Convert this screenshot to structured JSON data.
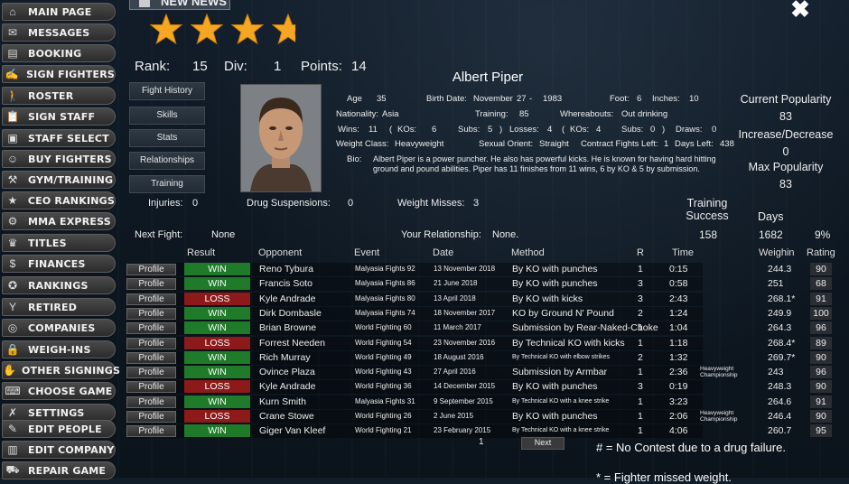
{
  "sidebar": {
    "items": [
      {
        "label": "MAIN PAGE",
        "icon": "house-icon"
      },
      {
        "label": "MESSAGES",
        "icon": "envelope-icon"
      },
      {
        "label": "BOOKING",
        "icon": "document-icon"
      },
      {
        "label": "SIGN FIGHTERS",
        "icon": "contract-icon"
      },
      {
        "label": "ROSTER",
        "icon": "fighter-icon"
      },
      {
        "label": "SIGN STAFF",
        "icon": "clipboard-icon"
      },
      {
        "label": "STAFF SELECT",
        "icon": "cube-icon"
      },
      {
        "label": "BUY FIGHTERS",
        "icon": "portrait-icon"
      },
      {
        "label": "GYM/TRAINING",
        "icon": "dumbbell-icon"
      },
      {
        "label": "CEO RANKINGS",
        "icon": "star-icon"
      },
      {
        "label": "MMA EXPRESS",
        "icon": "gear-icon"
      },
      {
        "label": "TITLES",
        "icon": "trophy-icon"
      },
      {
        "label": "FINANCES",
        "icon": "money-bag-icon"
      },
      {
        "label": "RANKINGS",
        "icon": "medal-icon"
      },
      {
        "label": "RETIRED",
        "icon": "cocktail-icon"
      },
      {
        "label": "COMPANIES",
        "icon": "globe-icon"
      },
      {
        "label": "WEIGH-INS",
        "icon": "lock-icon"
      },
      {
        "label": "OTHER SIGNINGS",
        "icon": "handshake-icon"
      },
      {
        "label": "CHOOSE GAME",
        "icon": "controller-icon"
      },
      {
        "label": "SETTINGS",
        "icon": "wrench-icon"
      },
      {
        "label": "EDIT PEOPLE",
        "icon": "pencil-icon"
      },
      {
        "label": "EDIT COMPANY",
        "icon": "building-icon"
      },
      {
        "label": "REPAIR GAME",
        "icon": "car-icon"
      }
    ]
  },
  "header": {
    "news_label": "NEW NEWS",
    "stars": 3.5
  },
  "summary": {
    "rank_label": "Rank:",
    "rank": "15",
    "div_label": "Div:",
    "div": "1",
    "points_label": "Points:",
    "points": "14"
  },
  "fighter": {
    "name": "Albert Piper",
    "age_label": "Age",
    "age": "35",
    "birth_label": "Birth Date:",
    "birth_month": "November",
    "birth_day": "27",
    "birth_year": "1983",
    "foot_label": "Foot:",
    "foot": "6",
    "inches_label": "Inches:",
    "inches": "10",
    "nationality_label": "Nationality:",
    "nationality": "Asia",
    "training_label": "Training:",
    "training": "85",
    "whereabouts_label": "Whereabouts:",
    "whereabouts": "Out drinking",
    "wins_label": "Wins:",
    "wins": "11",
    "kos_label": "KOs:",
    "kos": "6",
    "subs_label": "Subs:",
    "subs": "5",
    "losses_label": "Losses:",
    "losses": "4",
    "kos2": "4",
    "subs2": "0",
    "draws_label": "Draws:",
    "draws": "0",
    "weight_class_label": "Weight Class:",
    "weight_class": "Heavyweight",
    "orient_label": "Sexual Orient:",
    "orient": "Straight",
    "contract_label": "Contract Fights Left:",
    "contract": "1",
    "days_left_label": "Days Left:",
    "days_left": "438",
    "bio_label": "Bio:",
    "bio": "Albert Piper is a power puncher. He also has powerful kicks. He is known for having hard hitting ground and pound abilities. Piper has 11 finishes from 11 wins, 6 by KO & 5 by submission."
  },
  "tabs": [
    "Fight History",
    "Skills",
    "Stats",
    "Relationships",
    "Training"
  ],
  "popularity": {
    "current_label": "Current Popularity",
    "current": "83",
    "change_label": "Increase/Decrease",
    "change": "0",
    "max_label": "Max Popularity",
    "max": "83"
  },
  "status": {
    "injuries_label": "Injuries:",
    "injuries": "0",
    "drug_label": "Drug Suspensions:",
    "drug": "0",
    "weight_label": "Weight Misses:",
    "weight": "3",
    "training_success_label": "Training Success",
    "training_success": "158",
    "days_label": "Days",
    "days": "1682",
    "pct": "9%",
    "next_fight_label": "Next Fight:",
    "next_fight": "None",
    "relationship_label": "Your Relationship:",
    "relationship": "None."
  },
  "table": {
    "headers": {
      "result": "Result",
      "opponent": "Opponent",
      "event": "Event",
      "date": "Date",
      "method": "Method",
      "round": "R",
      "time": "Time",
      "weighin": "Weighin",
      "rating": "Rating"
    },
    "profile_label": "Profile",
    "rows": [
      {
        "result": "WIN",
        "opponent": "Reno Tybura",
        "event": "Malyasia Fights 92",
        "date": "13 November 2018",
        "method": "By KO with punches",
        "r": "1",
        "time": "0:15",
        "title": "",
        "weighin": "244.3",
        "rating": "90"
      },
      {
        "result": "WIN",
        "opponent": "Francis Soto",
        "event": "Malyasia Fights 86",
        "date": "21 June 2018",
        "method": "By KO with punches",
        "r": "3",
        "time": "0:58",
        "title": "",
        "weighin": "251",
        "rating": "68"
      },
      {
        "result": "LOSS",
        "opponent": "Kyle Andrade",
        "event": "Malyasia Fights 80",
        "date": "13 April 2018",
        "method": "By KO with kicks",
        "r": "3",
        "time": "2:43",
        "title": "",
        "weighin": "268.1*",
        "rating": "91"
      },
      {
        "result": "WIN",
        "opponent": "Dirk Dombasle",
        "event": "Malyasia Fights 74",
        "date": "18 November 2017",
        "method": "KO by Ground N' Pound",
        "r": "2",
        "time": "1:24",
        "title": "",
        "weighin": "249.9",
        "rating": "100"
      },
      {
        "result": "WIN",
        "opponent": "Brian Browne",
        "event": "World Fighting 60",
        "date": "11 March 2017",
        "method": "Submission by Rear-Naked-Choke",
        "r": "1",
        "time": "1:04",
        "title": "",
        "weighin": "264.3",
        "rating": "96"
      },
      {
        "result": "LOSS",
        "opponent": "Forrest Needen",
        "event": "World Fighting 54",
        "date": "23 November 2016",
        "method": "By Technical KO with kicks",
        "r": "1",
        "time": "1:18",
        "title": "",
        "weighin": "268.4*",
        "rating": "89"
      },
      {
        "result": "WIN",
        "opponent": "Rich Murray",
        "event": "World Fighting 49",
        "date": "18 August 2016",
        "method": "By Technical KO with elbow strikes",
        "r": "2",
        "time": "1:32",
        "title": "",
        "weighin": "269.7*",
        "rating": "90"
      },
      {
        "result": "WIN",
        "opponent": "Ovince Plaza",
        "event": "World Fighting 43",
        "date": "27 April 2016",
        "method": "Submission by Armbar",
        "r": "1",
        "time": "2:36",
        "title": "Heavyweight Championship",
        "weighin": "243",
        "rating": "96"
      },
      {
        "result": "LOSS",
        "opponent": "Kyle Andrade",
        "event": "World Fighting 36",
        "date": "14 December 2015",
        "method": "By KO with punches",
        "r": "3",
        "time": "0:19",
        "title": "",
        "weighin": "248.3",
        "rating": "90"
      },
      {
        "result": "WIN",
        "opponent": "Kurn Smith",
        "event": "Malyasia Fights 31",
        "date": "9 September 2015",
        "method": "By Technical KO with a knee strike",
        "r": "1",
        "time": "3:23",
        "title": "",
        "weighin": "264.6",
        "rating": "91"
      },
      {
        "result": "LOSS",
        "opponent": "Crane Stowe",
        "event": "World Fighting 26",
        "date": "2 June 2015",
        "method": "By KO with punches",
        "r": "1",
        "time": "2:06",
        "title": "Heavyweight Championship",
        "weighin": "246.4",
        "rating": "90"
      },
      {
        "result": "WIN",
        "opponent": "Giger Van Kleef",
        "event": "World Fighting 21",
        "date": "23 February 2015",
        "method": "By Technical KO with a knee strike",
        "r": "1",
        "time": "4:06",
        "title": "",
        "weighin": "260.7",
        "rating": "95"
      }
    ]
  },
  "pager": {
    "page": "1",
    "next_label": "Next"
  },
  "notes": {
    "no_contest": "# = No Contest due to a drug failure.",
    "missed_weight": "* = Fighter missed weight."
  }
}
